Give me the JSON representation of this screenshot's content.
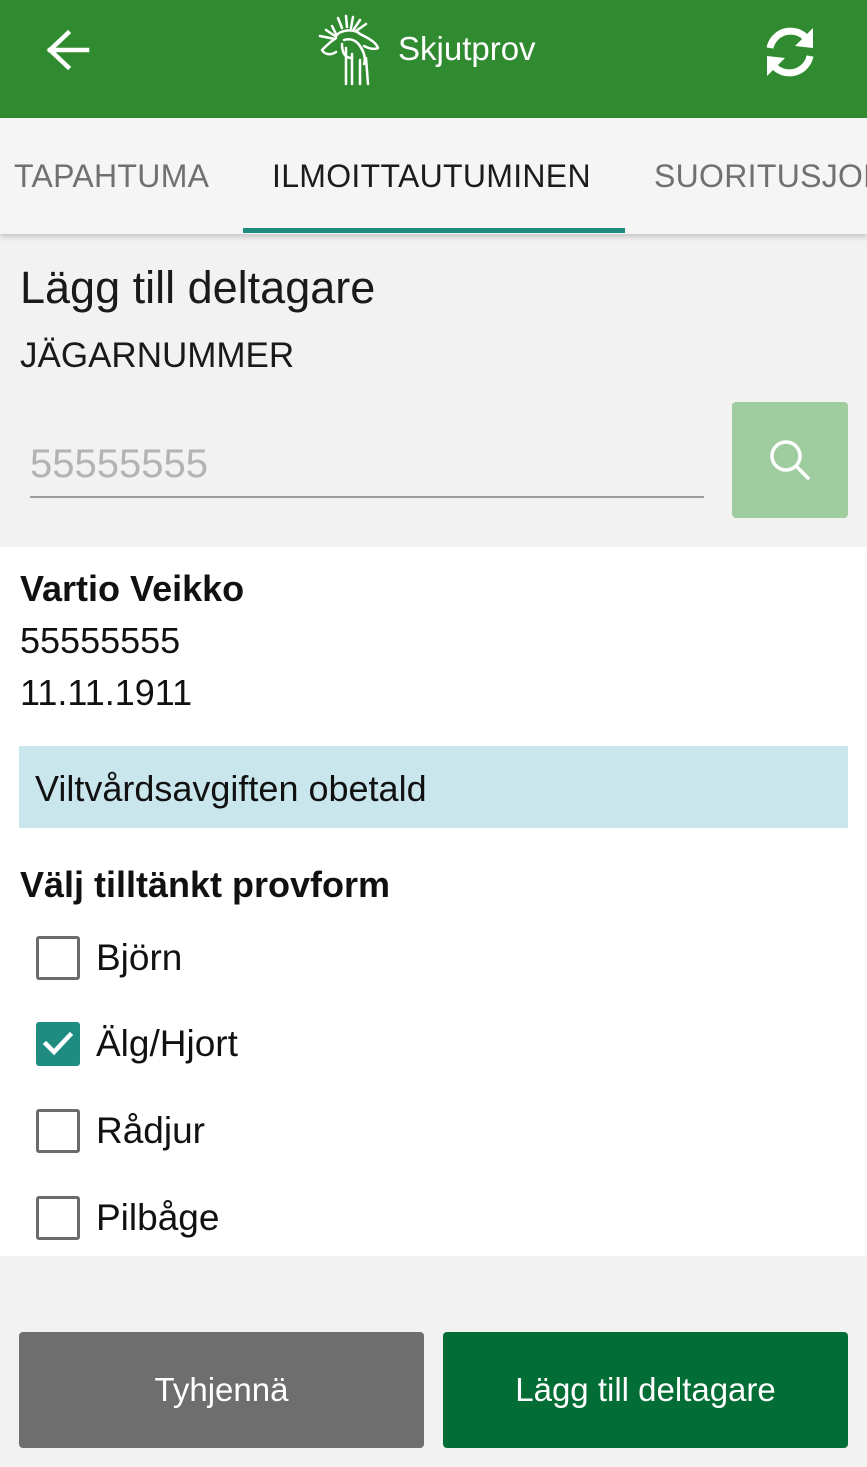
{
  "app_bar": {
    "title": "Skjutprov",
    "back_icon": "arrow-left-icon",
    "logo_icon": "moose-logo-icon",
    "refresh_icon": "refresh-icon",
    "background_color": "#308b30"
  },
  "tabs": [
    {
      "label": "TAPAHTUMA",
      "active": false
    },
    {
      "label": "ILMOITTAUTUMINEN",
      "active": true
    },
    {
      "label": "SUORITUSJONO",
      "active": false
    }
  ],
  "form": {
    "section_title": "Lägg till deltagare",
    "hunter_number_label": "JÄGARNUMMER",
    "hunter_number_placeholder": "55555555",
    "hunter_number_value": "",
    "search_icon": "search-icon"
  },
  "person": {
    "name": "Vartio Veikko",
    "hunter_number": "55555555",
    "birth_date": "11.11.1911",
    "fee_status": "Viltvårdsavgiften obetald"
  },
  "test_types": {
    "title": "Välj tilltänkt provform",
    "options": [
      {
        "label": "Björn",
        "checked": false
      },
      {
        "label": "Älg/Hjort",
        "checked": true
      },
      {
        "label": "Rådjur",
        "checked": false
      },
      {
        "label": "Pilbåge",
        "checked": false
      }
    ]
  },
  "actions": {
    "clear_label": "Tyhjennä",
    "add_label": "Lägg till deltagare"
  },
  "colors": {
    "accent": "#1f8c82",
    "primary_button": "#036d36",
    "secondary_button": "#6e6e6e",
    "info_banner": "#c9e6ec"
  }
}
